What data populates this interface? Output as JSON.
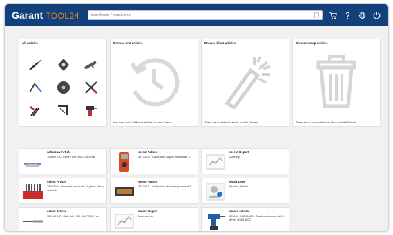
{
  "header": {
    "brand_main": "Garant",
    "brand_sub": "TOOL24",
    "search_placeholder": "enter/tender / search term",
    "colors": {
      "bar": "#11407a",
      "accent": "#f08a1c"
    },
    "icons": [
      "star-icon",
      "cart-icon",
      "help-icon",
      "settings-icon",
      "power-icon"
    ]
  },
  "panels": [
    {
      "title": "All articles",
      "footer": ""
    },
    {
      "title": "Browse lent articles",
      "footer": "You have lent 0 different articles, in total 0 items."
    },
    {
      "title": "Browse blunt articles",
      "footer": "There are 0 articles in stock, in total 0 items."
    },
    {
      "title": "Browse scrap articles",
      "footer": "There are 0 scrap articles in stock, in total 0 items."
    }
  ],
  "cards": [
    {
      "title": "withdraw Article",
      "desc": "111060 6.3 - Centre drill HSS-E 6.3 mm"
    },
    {
      "title": "select Article",
      "desc": "217710 3 - Calibration Digital multimeter 3"
    },
    {
      "title": "select Report",
      "desc": "Quantity"
    },
    {
      "title": "select Article",
      "desc": "380420 6 - Assorted punch set 10-piece Mono sculpt 6"
    },
    {
      "title": "select Article",
      "desc": "311240 3 - Calibration Measuring Internal 3"
    },
    {
      "title": "show User",
      "desc": "Service, Admin"
    },
    {
      "title": "select Article",
      "desc": "113140 3.7 - Stub drill HSS Cut FS 3.7 mm"
    },
    {
      "title": "select Report",
      "desc": "Movements"
    },
    {
      "title": "select Article",
      "desc": "070160 GSB1860C - Cordless hammer drill / driver GSB1860C"
    }
  ]
}
